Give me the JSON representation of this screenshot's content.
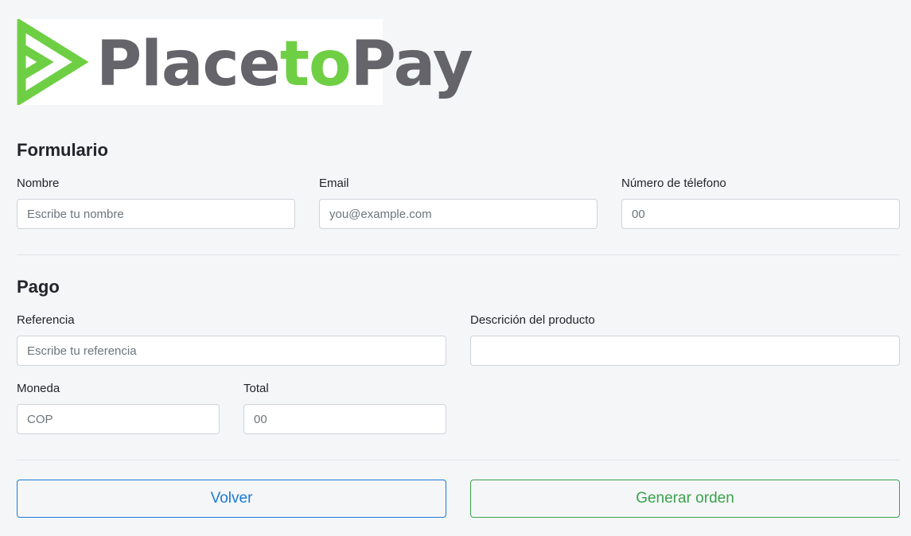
{
  "brand": {
    "name_part1": "Place",
    "name_part2": "to",
    "name_part3": "Pay",
    "primary_color": "#64646a",
    "accent_color": "#6fcf44",
    "icon": "play-triangle-icon"
  },
  "form": {
    "title": "Formulario",
    "name": {
      "label": "Nombre",
      "placeholder": "Escribe tu nombre"
    },
    "email": {
      "label": "Email",
      "placeholder": "you@example.com"
    },
    "phone": {
      "label": "Número de télefono",
      "placeholder": "00"
    }
  },
  "payment": {
    "title": "Pago",
    "reference": {
      "label": "Referencia",
      "placeholder": "Escribe tu referencia"
    },
    "description": {
      "label": "Descrición del producto",
      "placeholder": ""
    },
    "currency": {
      "label": "Moneda",
      "placeholder": "COP"
    },
    "total": {
      "label": "Total",
      "placeholder": "00"
    }
  },
  "actions": {
    "back_label": "Volver",
    "back_color": "#1a7bd6",
    "order_label": "Generar orden",
    "order_color": "#3aa14d"
  }
}
